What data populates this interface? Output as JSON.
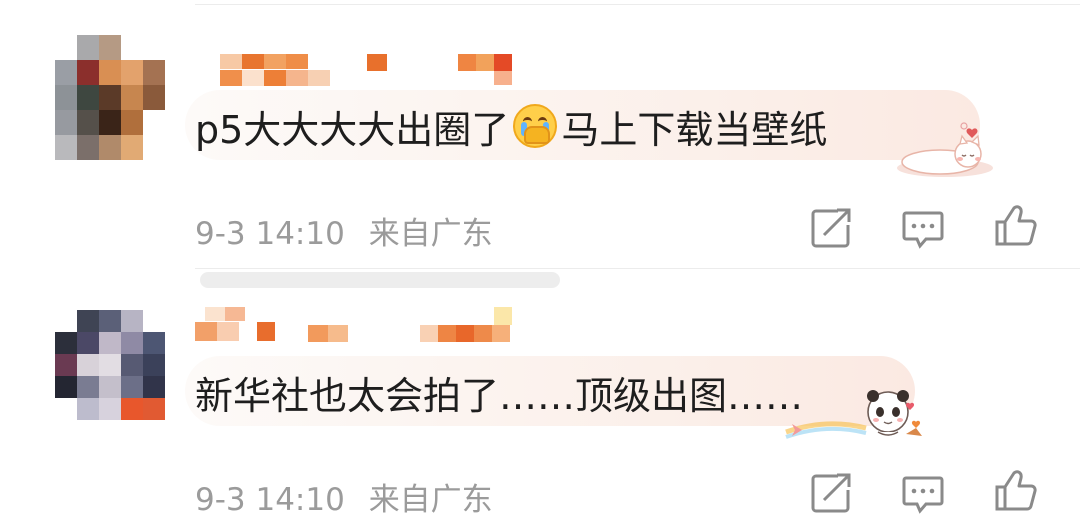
{
  "comments": [
    {
      "text_before": "p5大大大大出圈了",
      "emoji": "crying-face-covering-mouth",
      "text_after": "马上下载当壁纸",
      "date": "9-3 14:10",
      "location": "来自广东",
      "sticker": "sleeping-cat-sticker"
    },
    {
      "text": "新华社也太会拍了……顶级出图……",
      "date": "9-3 14:10",
      "location": "来自广东",
      "sticker": "panda-rainbow-sticker"
    }
  ],
  "actions": {
    "repost_icon": "share-box-icon",
    "comment_icon": "comment-bubble-icon",
    "like_icon": "thumbs-up-icon"
  },
  "colors": {
    "comment_text": "#1e1e1e",
    "meta_text": "#9b9b9b",
    "icon_stroke": "#8a8a8a",
    "bubble_tint": "#fbefe9"
  }
}
